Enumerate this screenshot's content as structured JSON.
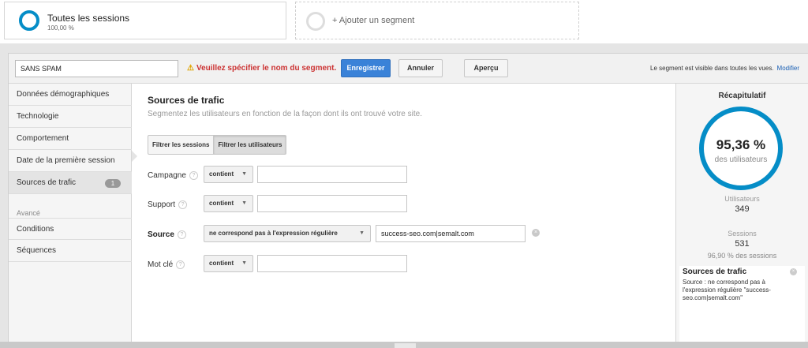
{
  "segments": {
    "current": {
      "name": "Toutes les sessions",
      "percent": "100,00 %"
    },
    "add_label": "+ Ajouter un segment"
  },
  "editor": {
    "name_value": "SANS SPAM",
    "warning": "Veuillez spécifier le nom du segment.",
    "save_label": "Enregistrer",
    "cancel_label": "Annuler",
    "preview_label": "Aperçu",
    "visibility_note": "Le segment est visible dans toutes les vues.",
    "modify_link": "Modifier"
  },
  "nav": {
    "items": [
      {
        "label": "Données démographiques"
      },
      {
        "label": "Technologie"
      },
      {
        "label": "Comportement"
      },
      {
        "label": "Date de la première session"
      },
      {
        "label": "Sources de trafic",
        "badge": "1"
      }
    ],
    "advanced_label": "Avancé",
    "advanced_items": [
      {
        "label": "Conditions"
      },
      {
        "label": "Séquences"
      }
    ]
  },
  "main": {
    "title": "Sources de trafic",
    "subtitle": "Segmentez les utilisateurs en fonction de la façon dont ils ont trouvé votre site.",
    "toggle": {
      "sessions": "Filtrer les sessions",
      "users": "Filtrer les utilisateurs"
    },
    "rows": [
      {
        "label": "Campagne",
        "operator": "contient",
        "value": ""
      },
      {
        "label": "Support",
        "operator": "contient",
        "value": ""
      },
      {
        "label": "Source",
        "operator": "ne correspond pas à l'expression régulière",
        "value": "success-seo.com|semalt.com"
      },
      {
        "label": "Mot clé",
        "operator": "contient",
        "value": ""
      }
    ],
    "help_glyph": "?"
  },
  "summary": {
    "title": "Récapitulatif",
    "percent": "95,36 %",
    "percent_unit": "des utilisateurs",
    "users_label": "Utilisateurs",
    "users_value": "349",
    "sessions_label": "Sessions",
    "sessions_value": "531",
    "sessions_pct": "96,90 % des sessions",
    "filter_title": "Sources de trafic",
    "filter_desc": "Source : ne correspond pas à l'expression régulière \"success-seo.com|semalt.com\""
  },
  "icons": {
    "warning": "⚠",
    "caret": "▼",
    "clear": "×"
  },
  "colors": {
    "accent": "#058dc7",
    "save": "#3a82d8",
    "warning": "#cc3333"
  }
}
